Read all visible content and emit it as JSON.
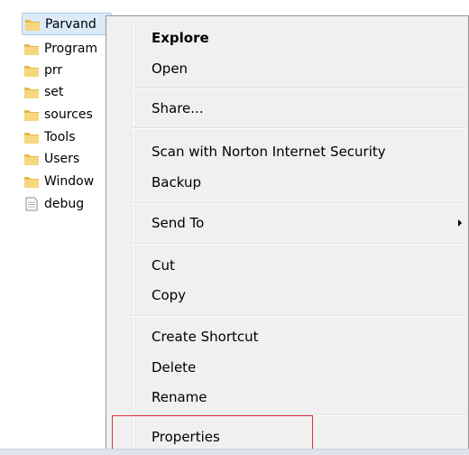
{
  "files": [
    {
      "name": "Parvand",
      "type": "folder",
      "selected": true
    },
    {
      "name": "Program",
      "type": "folder"
    },
    {
      "name": "prr",
      "type": "folder"
    },
    {
      "name": "set",
      "type": "folder"
    },
    {
      "name": "sources",
      "type": "folder"
    },
    {
      "name": "Tools",
      "type": "folder"
    },
    {
      "name": "Users",
      "type": "folder"
    },
    {
      "name": "Window",
      "type": "folder"
    },
    {
      "name": "debug",
      "type": "file"
    }
  ],
  "context_menu": {
    "items": [
      {
        "label": "Explore",
        "bold": true
      },
      {
        "label": "Open"
      },
      {
        "label": "Share..."
      },
      {
        "label": "Scan with Norton Internet Security"
      },
      {
        "label": "Backup"
      },
      {
        "label": "Send To",
        "submenu": true
      },
      {
        "label": "Cut"
      },
      {
        "label": "Copy"
      },
      {
        "label": "Create Shortcut"
      },
      {
        "label": "Delete"
      },
      {
        "label": "Rename"
      },
      {
        "label": "Properties",
        "highlighted": true
      }
    ]
  },
  "colors": {
    "menu_background": "#f0f0f0",
    "selection": "#dceaf8",
    "highlight_outline": "#e0303a",
    "folder_yellow": "#f3cf6a"
  },
  "icons": {
    "folder": "folder-icon",
    "file": "document-icon",
    "submenu": "chevron-right-icon"
  }
}
